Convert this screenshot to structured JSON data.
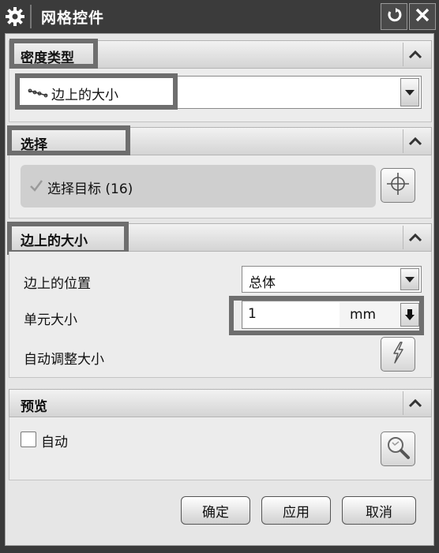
{
  "window": {
    "title": "网格控件",
    "icons": {
      "settings": "gear-icon",
      "reset": "reset-icon",
      "close": "close-icon"
    }
  },
  "density_section": {
    "header": "密度类型",
    "dropdown_value": "边上的大小",
    "icons": {
      "option": "edge-size-icon",
      "collapse": "chevron-up-icon",
      "arrow": "chevron-down-icon"
    }
  },
  "select_section": {
    "header": "选择",
    "select_target_label": "选择目标 (16)",
    "icons": {
      "check": "checkmark-icon",
      "crosshair": "crosshair-icon",
      "collapse": "chevron-up-icon"
    }
  },
  "edge_size_section": {
    "header": "边上的大小",
    "position_label": "边上的位置",
    "position_value": "总体",
    "element_size_label": "单元大小",
    "element_size_value": "1",
    "element_size_unit": "mm",
    "auto_adjust_label": "自动调整大小",
    "icons": {
      "auto_adjust": "lightning-icon",
      "unit_menu": "arrow-down-icon",
      "collapse": "chevron-up-icon"
    }
  },
  "preview_section": {
    "header": "预览",
    "auto_label": "自动",
    "auto_checked": false,
    "icons": {
      "preview": "magnifier-icon",
      "collapse": "chevron-up-icon"
    }
  },
  "footer": {
    "ok_label": "确定",
    "apply_label": "应用",
    "cancel_label": "取消"
  },
  "colors": {
    "title_bar": "#3b3b3b",
    "panel": "#e6e6e6",
    "highlight_box": "#6e6e6e"
  }
}
